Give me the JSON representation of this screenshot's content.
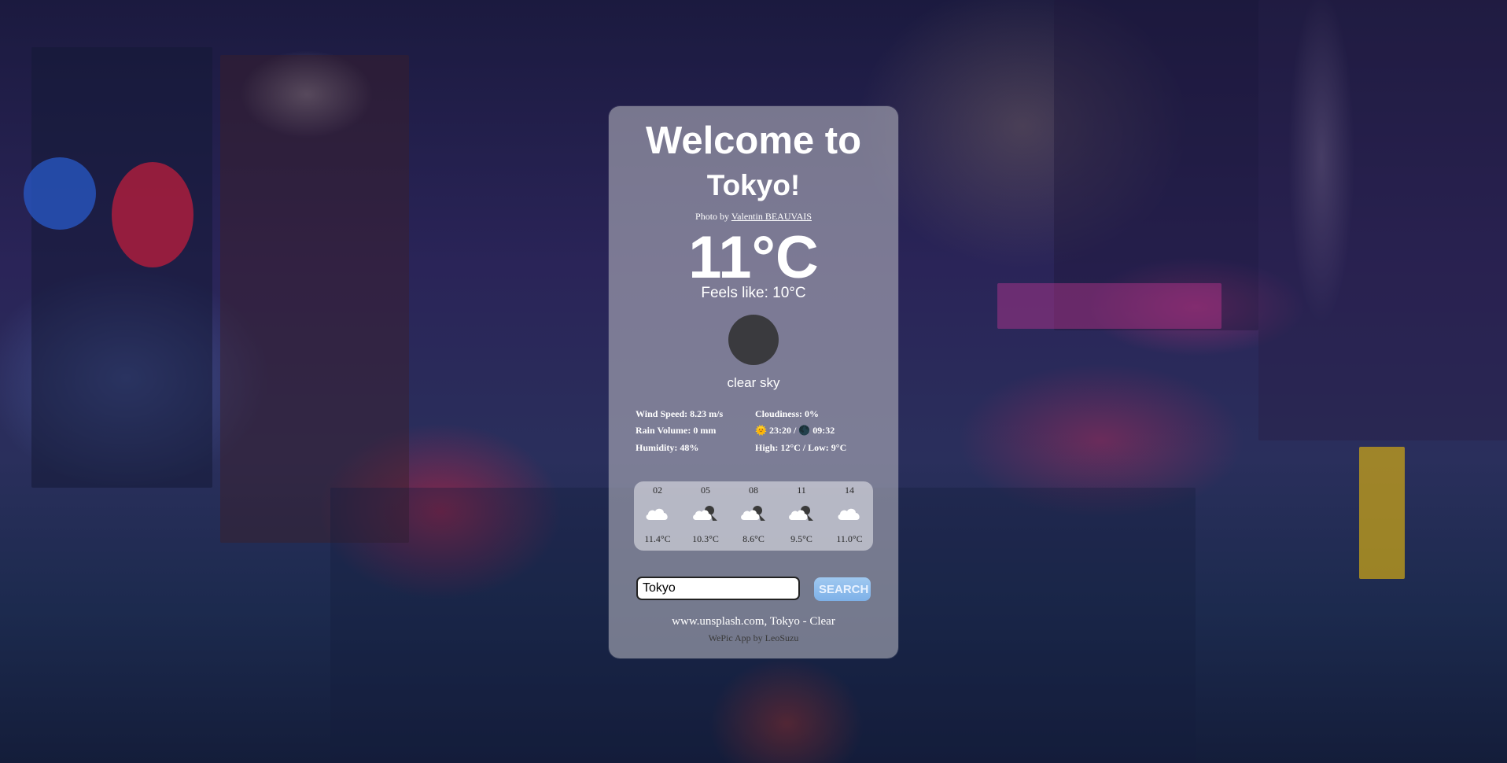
{
  "header": {
    "line1": "Welcome to",
    "line2": "Tokyo!"
  },
  "credit": {
    "prefix": "Photo by",
    "author": "Valentin BEAUVAIS"
  },
  "current": {
    "temperature": "11°C",
    "feels_like": "Feels like: 10°C",
    "description": "clear sky",
    "icon": "clear-night-icon"
  },
  "stats": {
    "wind_speed": "Wind Speed: 8.23 m/s",
    "rain_volume": "Rain Volume: 0 mm",
    "humidity": "Humidity: 48%",
    "cloudiness": "Cloudiness: 0%",
    "sun_times": "🌞 23:20 / 🌑 09:32",
    "high_low": "High: 12°C / Low: 9°C"
  },
  "forecast": [
    {
      "hour": "02",
      "temp": "11.4°C",
      "icon": "cloud-icon"
    },
    {
      "hour": "05",
      "temp": "10.3°C",
      "icon": "cloud-moon-icon"
    },
    {
      "hour": "08",
      "temp": "8.6°C",
      "icon": "cloud-moon-icon"
    },
    {
      "hour": "11",
      "temp": "9.5°C",
      "icon": "cloud-moon-icon"
    },
    {
      "hour": "14",
      "temp": "11.0°C",
      "icon": "cloud-icon"
    }
  ],
  "search": {
    "value": "Tokyo",
    "button_label": "SEARCH"
  },
  "footer": {
    "source": "www.unsplash.com, Tokyo - Clear",
    "credit": "WePic App by LeoSuzu"
  },
  "colors": {
    "card_bg": "#afafb9",
    "search_button": "#8dbcec",
    "icon_dark": "#3a3a3e"
  }
}
